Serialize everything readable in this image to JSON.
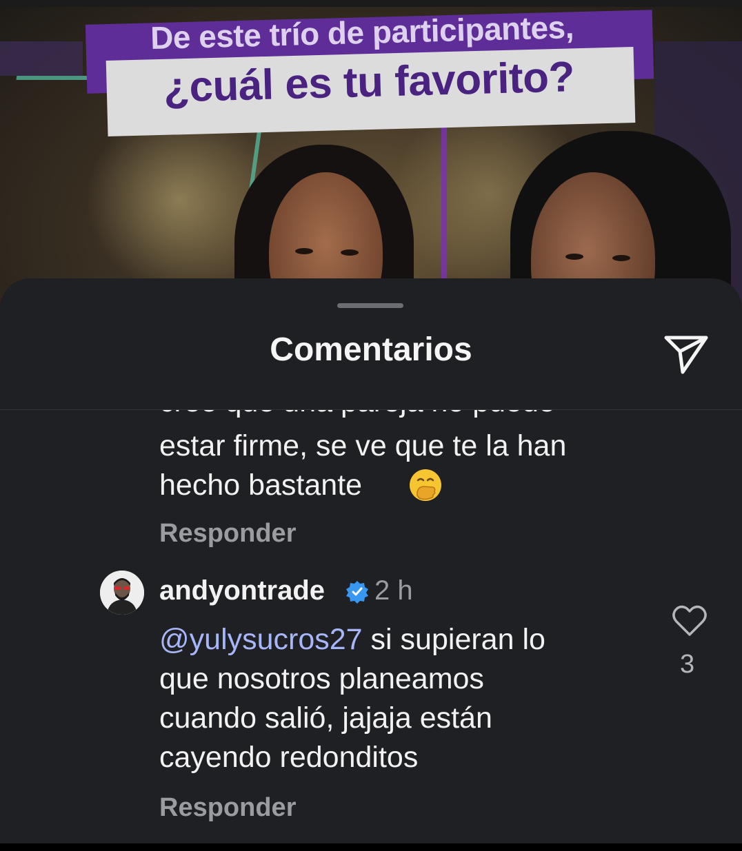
{
  "post": {
    "headline_line1": "De este trío de participantes,",
    "headline_line2": "¿cuál es tu favorito?"
  },
  "sheet": {
    "title": "Comentarios"
  },
  "previous_comment": {
    "cut_line": "cree que una pareja no puede",
    "text_line1": "estar firme, se ve que te la han",
    "text_line2": "hecho bastante",
    "emoji": "face-with-hand-over-mouth",
    "reply_label": "Responder"
  },
  "comment": {
    "username": "andyontrade",
    "verified": true,
    "time": "2 h",
    "mention": "@yulysucros27",
    "text_line1_rest": " si supieran lo",
    "text_line2": "que nosotros planeamos",
    "text_line3": "cuando salió, jajaja están",
    "text_line4": "cayendo redonditos",
    "likes": "3",
    "reply_label": "Responder"
  },
  "colors": {
    "sheet_bg": "#1f2024",
    "mention": "#a7b6f8",
    "verified": "#3897f0",
    "headline_purple": "#5e2d98"
  }
}
